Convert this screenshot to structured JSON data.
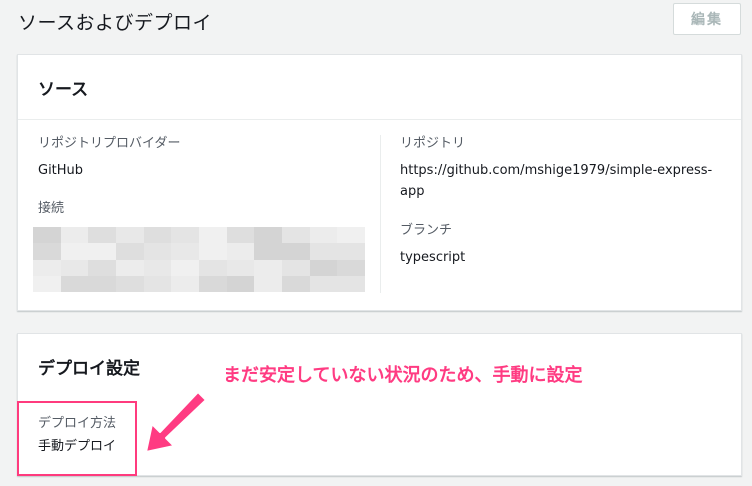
{
  "header": {
    "title": "ソースおよびデプロイ",
    "edit_label": "編集"
  },
  "source": {
    "title": "ソース",
    "provider_label": "リポジトリプロバイダー",
    "provider_value": "GitHub",
    "connection_label": "接続",
    "repository_label": "リポジトリ",
    "repository_value": "https://github.com/mshige1979/simple-express-app",
    "branch_label": "ブランチ",
    "branch_value": "typescript"
  },
  "deploy": {
    "title": "デプロイ設定",
    "method_label": "デプロイ方法",
    "method_value": "手動デプロイ"
  },
  "annotation": {
    "text": "まだ安定していない状況のため、手動に設定",
    "color": "#ff3b82"
  }
}
